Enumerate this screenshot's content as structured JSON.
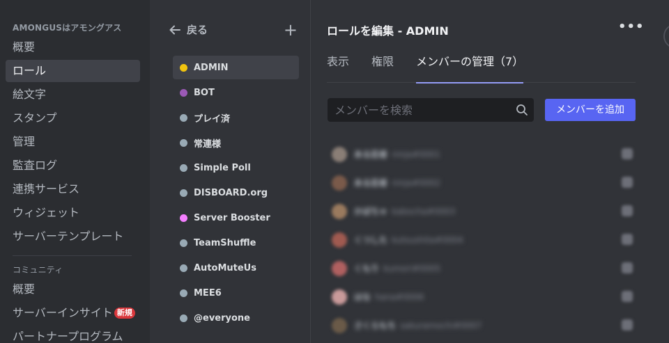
{
  "sidebar": {
    "server_header": "AMONGUSはアモングアス",
    "items": [
      "概要",
      "ロール",
      "絵文字",
      "スタンプ",
      "管理",
      "監査ログ",
      "連携サービス",
      "ウィジェット",
      "サーバーテンプレート"
    ],
    "community_header": "コミュニティ",
    "community_items": [
      "概要",
      "サーバーインサイト",
      "パートナープログラム"
    ],
    "new_badge": "新規"
  },
  "roles_panel": {
    "back_label": "戻る",
    "roles": [
      {
        "name": "ADMIN",
        "color": "#f1c40f"
      },
      {
        "name": "BOT",
        "color": "#9b59b6"
      },
      {
        "name": "プレイ済",
        "color": "#99aab5"
      },
      {
        "name": "常連様",
        "color": "#99aab5"
      },
      {
        "name": "Simple Poll",
        "color": "#99aab5"
      },
      {
        "name": "DISBOARD.org",
        "color": "#99aab5"
      },
      {
        "name": "Server Booster",
        "color": "#f47fff"
      },
      {
        "name": "TeamShuffle",
        "color": "#99aab5"
      },
      {
        "name": "AutoMuteUs",
        "color": "#99aab5"
      },
      {
        "name": "MEE6",
        "color": "#99aab5"
      },
      {
        "name": "@everyone",
        "color": "#99aab5"
      }
    ]
  },
  "main": {
    "title": "ロールを編集 - ADMIN",
    "tabs": [
      "表示",
      "権限",
      "メンバーの管理（7）"
    ],
    "search_placeholder": "メンバーを検索",
    "add_member_label": "メンバーを追加"
  },
  "members": [
    {
      "name": "ある忍者",
      "tag": "ninja#0001",
      "avatar": "#8a7e76"
    },
    {
      "name": "ある忍者",
      "tag": "ninja#0002",
      "avatar": "#7a5a4a"
    },
    {
      "name": "かぼちゃ",
      "tag": "kabocha#0003",
      "avatar": "#9a7a5e"
    },
    {
      "name": "くつした",
      "tag": "kutsushita#0004",
      "avatar": "#a05a50"
    },
    {
      "name": "くもり",
      "tag": "kumori#0005",
      "avatar": "#b06060"
    },
    {
      "name": "はな",
      "tag": "hana#0006",
      "avatar": "#c99a9a"
    },
    {
      "name": "さくらもち",
      "tag": "sakuramochi#0007",
      "avatar": "#6a5a48"
    }
  ]
}
